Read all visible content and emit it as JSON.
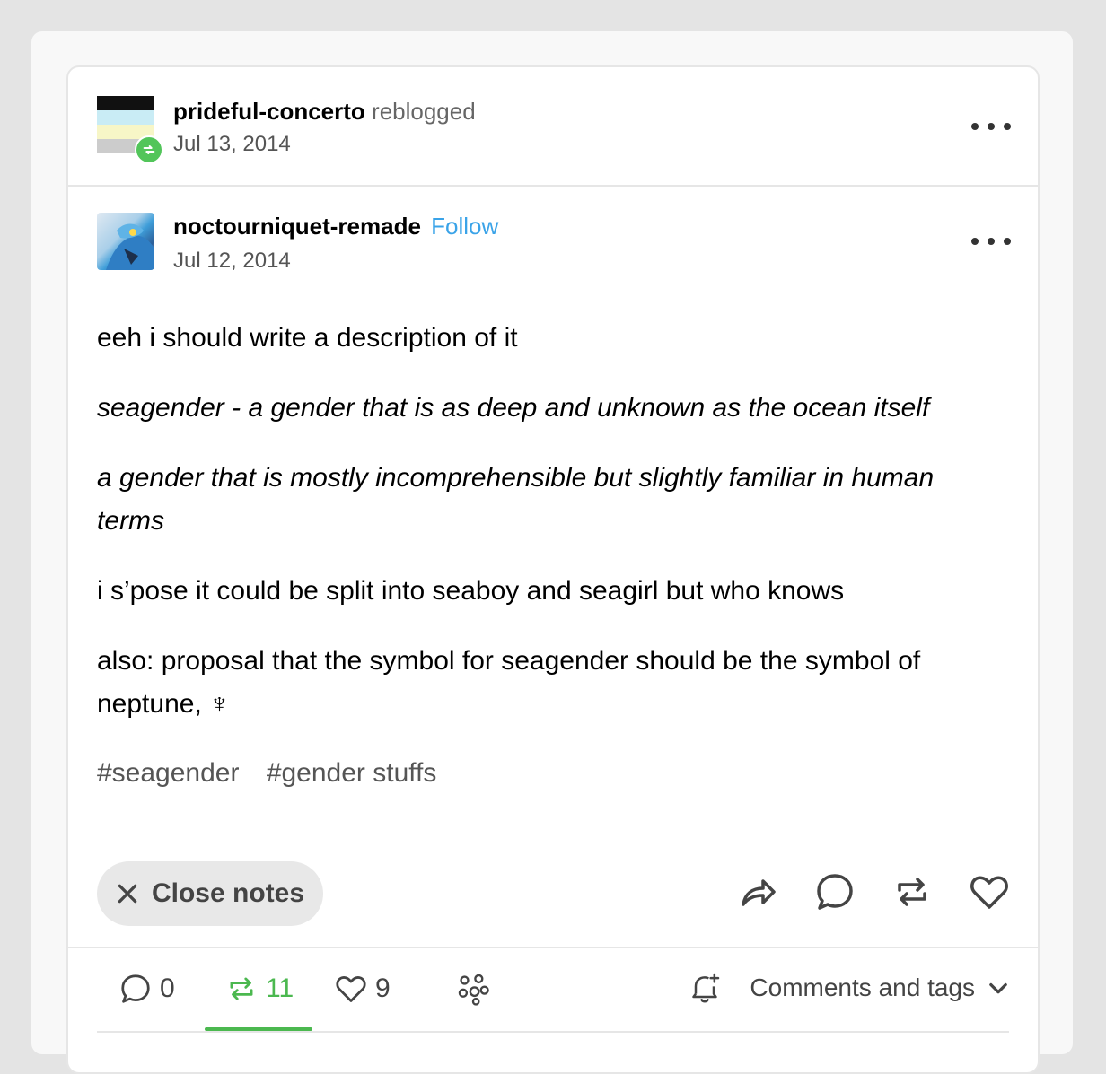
{
  "reblog_header": {
    "username": "prideful-concerto",
    "action": "reblogged",
    "date": "Jul 13, 2014",
    "avatar_colors": [
      "#111111",
      "#c9ecf5",
      "#f7f6c7",
      "#cccccc"
    ]
  },
  "original_post": {
    "username": "noctourniquet-remade",
    "follow_label": "Follow",
    "date": "Jul 12, 2014",
    "paragraphs": {
      "p1": "eeh i should write a description of it",
      "p2": "seagender - a gender that is as deep and unknown as the ocean itself",
      "p3": "a gender that is mostly incomprehensible but slightly familiar in human terms",
      "p4": "i s’pose it could be split into seaboy and seagirl but who knows",
      "p5": "also: proposal that the symbol for seagender should be the symbol of neptune, ♆"
    },
    "tags": [
      "#seagender",
      "#gender stuffs"
    ]
  },
  "controls": {
    "close_notes_label": "Close notes",
    "icons": [
      "share-icon",
      "reply-icon",
      "reblog-icon",
      "like-icon"
    ]
  },
  "notes": {
    "replies_count": "0",
    "reblogs_count": "11",
    "likes_count": "9",
    "comments_and_tags_label": "Comments and tags"
  },
  "colors": {
    "accent_green": "#4bb84f",
    "follow_blue": "#3aa3e8"
  }
}
